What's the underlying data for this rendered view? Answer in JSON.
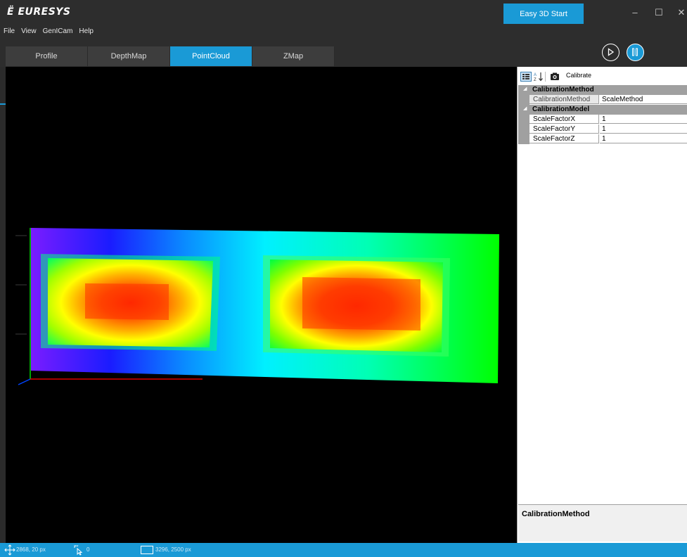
{
  "app": {
    "logo_text": "EURESYS",
    "start_button": "Easy 3D Start"
  },
  "window_controls": {
    "minimize": "–",
    "maximize": "☐",
    "close": "✕"
  },
  "menu": [
    "File",
    "View",
    "GenICam",
    "Help"
  ],
  "tabs": [
    {
      "label": "Profile",
      "active": false
    },
    {
      "label": "DepthMap",
      "active": false
    },
    {
      "label": "PointCloud",
      "active": true
    },
    {
      "label": "ZMap",
      "active": false
    }
  ],
  "playback": {
    "play_icon": "play-icon",
    "pause_icon": "pause-icon"
  },
  "property_panel": {
    "toolbar": {
      "calibrate_label": "Calibrate"
    },
    "categories": [
      {
        "name": "CalibrationMethod",
        "properties": [
          {
            "name": "CalibrationMethod",
            "value": "ScaleMethod"
          }
        ]
      },
      {
        "name": "CalibrationModel",
        "properties": [
          {
            "name": "ScaleFactorX",
            "value": "1"
          },
          {
            "name": "ScaleFactorY",
            "value": "1"
          },
          {
            "name": "ScaleFactorZ",
            "value": "1"
          }
        ]
      }
    ],
    "description_title": "CalibrationMethod"
  },
  "status": {
    "cursor_position": "2868, 20 px",
    "selection_count": "0",
    "image_size": "3296, 2500 px"
  },
  "colors": {
    "accent": "#1a9ad6",
    "background": "#2d2d2d",
    "viewport": "#000000"
  }
}
